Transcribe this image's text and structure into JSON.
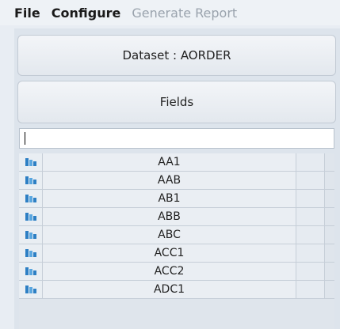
{
  "menu": {
    "file": "File",
    "configure": "Configure",
    "generate_report": "Generate Report"
  },
  "dataset_label": "Dataset : AORDER",
  "fields_label": "Fields",
  "search": {
    "value": ""
  },
  "fields": [
    "AA1",
    "AAB",
    "AB1",
    "ABB",
    "ABC",
    "ACC1",
    "ACC2",
    "ADC1"
  ]
}
